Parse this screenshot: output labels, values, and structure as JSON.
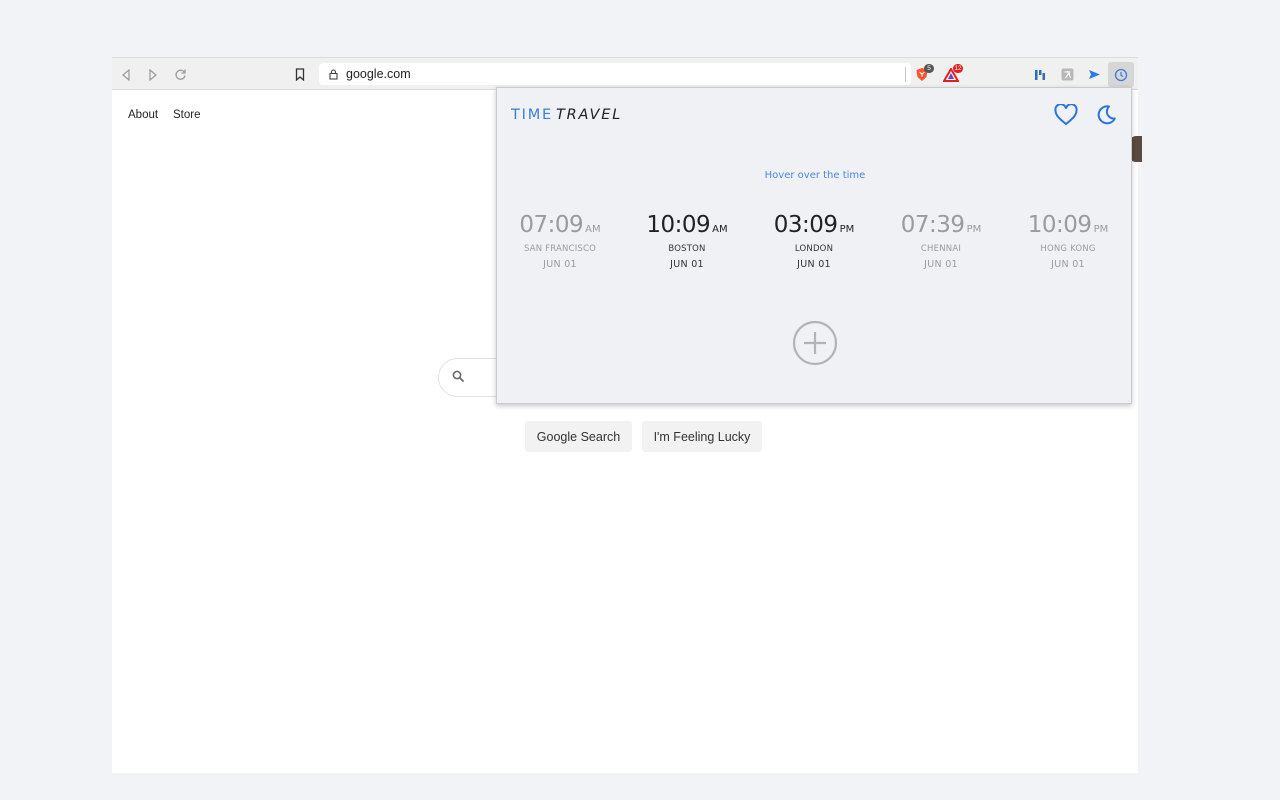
{
  "browser": {
    "url": "google.com",
    "extensions": [
      {
        "name": "brave-shield",
        "badge": "5",
        "badge_color": "#555555"
      },
      {
        "name": "brave-rewards",
        "badge": "12",
        "badge_color": "#e02020"
      }
    ]
  },
  "google": {
    "links": [
      "About",
      "Store"
    ],
    "search_button": "Google Search",
    "lucky_button": "I'm Feeling Lucky"
  },
  "popup": {
    "logo_part1": "TIME",
    "logo_part2": "TRAVEL",
    "hint": "Hover over the time",
    "accent_color": "#3b7ddd",
    "clocks": [
      {
        "time": "07:09",
        "ampm": "AM",
        "city": "SAN FRANCISCO",
        "date": "JUN 01",
        "state": "dim"
      },
      {
        "time": "10:09",
        "ampm": "AM",
        "city": "BOSTON",
        "date": "JUN 01",
        "state": "active"
      },
      {
        "time": "03:09",
        "ampm": "PM",
        "city": "LONDON",
        "date": "JUN 01",
        "state": "active"
      },
      {
        "time": "07:39",
        "ampm": "PM",
        "city": "CHENNAI",
        "date": "JUN 01",
        "state": "dim"
      },
      {
        "time": "10:09",
        "ampm": "PM",
        "city": "HONG KONG",
        "date": "JUN 01",
        "state": "dim"
      }
    ]
  }
}
